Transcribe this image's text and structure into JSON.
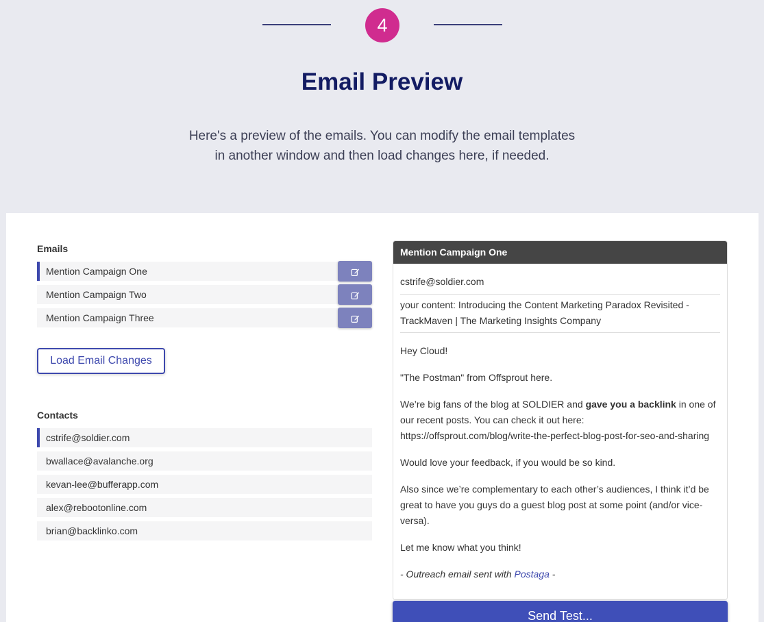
{
  "step": {
    "number": "4"
  },
  "header": {
    "title": "Email Preview",
    "subtitle_line1": "Here's a preview of the emails. You can modify the email templates",
    "subtitle_line2": "in another window and then load changes here, if needed."
  },
  "emails": {
    "label": "Emails",
    "items": [
      {
        "label": "Mention Campaign One",
        "active": true
      },
      {
        "label": "Mention Campaign Two",
        "active": false
      },
      {
        "label": "Mention Campaign Three",
        "active": false
      }
    ],
    "load_button": "Load Email Changes"
  },
  "contacts": {
    "label": "Contacts",
    "items": [
      {
        "label": "cstrife@soldier.com",
        "active": true
      },
      {
        "label": "bwallace@avalanche.org",
        "active": false
      },
      {
        "label": "kevan-lee@bufferapp.com",
        "active": false
      },
      {
        "label": "alex@rebootonline.com",
        "active": false
      },
      {
        "label": "brian@backlinko.com",
        "active": false
      }
    ]
  },
  "preview": {
    "title": "Mention Campaign One",
    "to": "cstrife@soldier.com",
    "subject": "your content: Introducing the Content Marketing Paradox Revisited - TrackMaven | The Marketing Insights Company",
    "greeting": "Hey Cloud!",
    "intro": "\"The Postman\" from Offsprout here.",
    "p1_before": "We’re big fans of the blog at SOLDIER and ",
    "p1_bold": "gave you a backlink",
    "p1_after": " in one of our recent posts. You can check it out here: https://offsprout.com/blog/write-the-perfect-blog-post-for-seo-and-sharing",
    "p2": "Would love your feedback, if you would be so kind.",
    "p3": "Also since we’re complementary to each other’s audiences, I think it’d be great to have you guys do a guest blog post at some point (and/or vice-versa).",
    "p4": "Let me know what you think!",
    "sig_before": "- Outreach email sent with ",
    "sig_link": "Postaga",
    "sig_after": " -"
  },
  "send_button": "Send Test...",
  "colors": {
    "accent": "#3d48ad",
    "step_circle": "#d02c8f",
    "title": "#131c63",
    "edit_button": "#7d82bd",
    "preview_header": "#454545",
    "page_background": "#e9eaf0"
  },
  "icons": {
    "edit": "edit-pencil-icon"
  }
}
